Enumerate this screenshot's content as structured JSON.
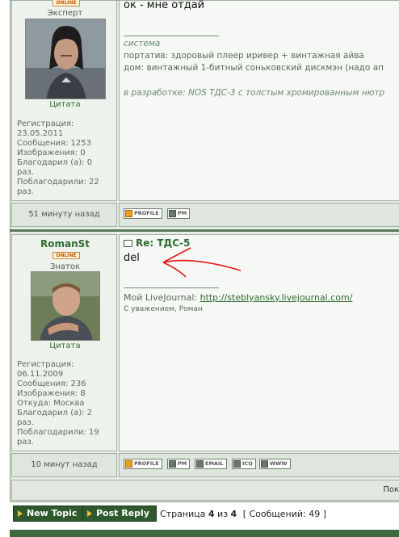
{
  "post1": {
    "online_badge": "ONLINE",
    "rank": "Эксперт",
    "quote_label": "Цитата",
    "stats": [
      "Регистрация:",
      "23.05.2011",
      "Сообщения: 1253",
      "Изображения: 0",
      "Благодарил (а): 0",
      "раз.",
      "Поблагодарили: 22",
      "раз."
    ],
    "text": "ок - мне отдай",
    "signature": {
      "heading": "система",
      "line1": "портатив: здоровый плеер иривер + винтажная айва",
      "line2": "дом: винтажный 1-битный соньковский дискмэн (надо ап",
      "line3": "в разработке: NOS ТДС-3 с толстым хромированным нютр"
    },
    "time": "51 минуту назад",
    "buttons": [
      "PROFILE",
      "PM"
    ]
  },
  "post2": {
    "username": "RomanSt",
    "online_badge": "ONLINE",
    "rank": "Знаток",
    "quote_label": "Цитата",
    "stats": [
      "Регистрация:",
      "06.11.2009",
      "Сообщения: 236",
      "Изображения: 8",
      "Откуда: Москва",
      "Благодарил (а): 2",
      "раз.",
      "Поблагодарили: 19",
      "раз."
    ],
    "title": "Re: ТДС-5",
    "text": "del",
    "signature": {
      "livejournal_label": "Мой LiveJournal:",
      "livejournal_url": "http://steblyansky.livejournal.com/",
      "regards": "С уважением, Роман"
    },
    "time": "10 минут назад",
    "buttons": [
      "PROFILE",
      "PM",
      "EMAIL",
      "ICQ",
      "WWW"
    ]
  },
  "footer": {
    "truncated_text": "Пок"
  },
  "actions": {
    "new_topic": "New Topic",
    "post_reply": "Post Reply"
  },
  "pagination": {
    "page_word": "Страница",
    "current": "4",
    "of_word": "из",
    "total": "4",
    "messages_label": "[ Сообщений: 49 ]"
  }
}
